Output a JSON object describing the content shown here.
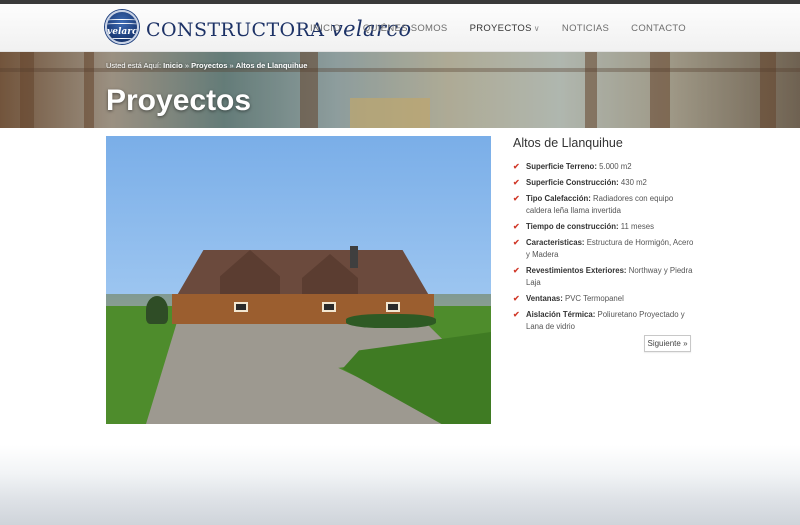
{
  "header": {
    "brand_part1": "CONSTRUCTORA",
    "brand_part2": "velarco",
    "logo_text": "velarco",
    "nav": [
      {
        "label": "INICIO"
      },
      {
        "label": "QUIÉNES SOMOS"
      },
      {
        "label": "PROYECTOS",
        "active": true,
        "icon": "chevron-down-icon"
      },
      {
        "label": "NOTICIAS"
      },
      {
        "label": "CONTACTO"
      }
    ]
  },
  "breadcrumb": {
    "prefix": "Usted está Aquí:",
    "items": [
      "Inicio",
      "Proyectos",
      "Altos de Llanquihue"
    ],
    "separator": "»"
  },
  "page": {
    "title": "Proyectos"
  },
  "project": {
    "title": "Altos de Llanquihue",
    "features": [
      {
        "label": "Superficie Terreno:",
        "value": "5.000 m2"
      },
      {
        "label": "Superficie Construcción:",
        "value": "430 m2"
      },
      {
        "label": "Tipo Calefacción:",
        "value": "Radiadores con equipo caldera leña llama invertida"
      },
      {
        "label": "Tiempo de construcción:",
        "value": "11 meses"
      },
      {
        "label": "Caracteristicas:",
        "value": "Estructura de Hormigón, Acero y Madera"
      },
      {
        "label": "Revestimientos Exteriores:",
        "value": "Northway y Piedra Laja"
      },
      {
        "label": "Ventanas:",
        "value": "PVC Termopanel"
      },
      {
        "label": "Aislación Térmica:",
        "value": "Poliuretano Proyectado y Lana de vidrio"
      }
    ],
    "next_label": "Siguiente »"
  },
  "colors": {
    "brand": "#1d3266",
    "check": "#d13b2c",
    "topbar": "#3a3a3a"
  }
}
